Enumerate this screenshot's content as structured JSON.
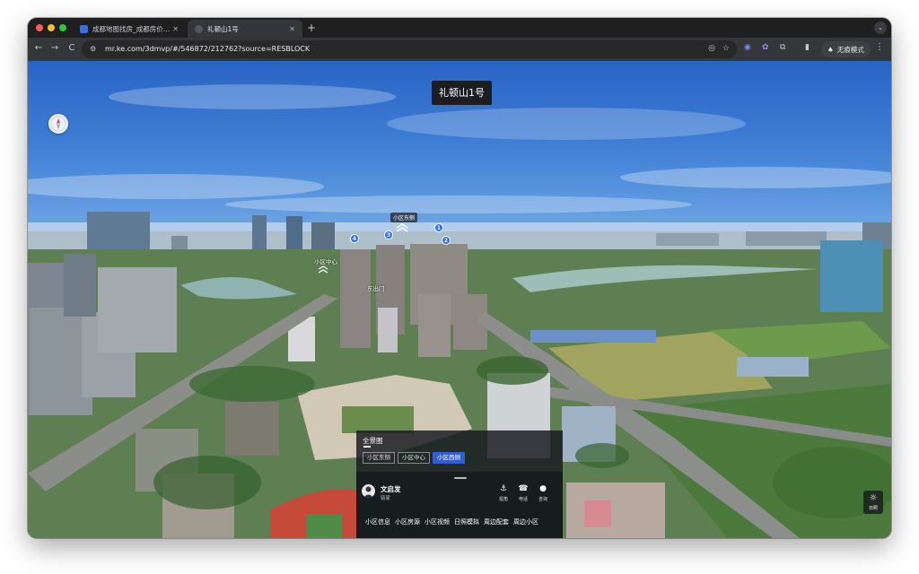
{
  "browser": {
    "tabs": [
      {
        "title": "成都地图找房_成都房价地图 |",
        "active": false
      },
      {
        "title": "礼顿山1号",
        "active": true
      }
    ],
    "new_tab": "+",
    "tab_menu": "⌄",
    "nav": {
      "back": "←",
      "forward": "→",
      "reload": "C"
    },
    "url": "mr.ke.com/3dmvp/#/546872/212762?source=RESBLOCK",
    "incognito_label": "无痕模式",
    "colors": {
      "tab_bg": "#1f1f1f",
      "toolbar_bg": "#35363a",
      "omnibox_bg": "#282828"
    }
  },
  "viewer": {
    "title": "礼顿山1号",
    "markers": [
      {
        "num": "1"
      },
      {
        "num": "2"
      },
      {
        "num": "3"
      },
      {
        "num": "4"
      }
    ],
    "labels": {
      "east": "小区东侧",
      "center": "小区中心",
      "exit": "东出门"
    },
    "panel": {
      "title": "全景图",
      "tabs": [
        {
          "label": "小区东侧",
          "active": false
        },
        {
          "label": "小区中心",
          "active": false
        },
        {
          "label": "小区西侧",
          "active": true
        }
      ],
      "agent": {
        "name": "文启发",
        "role": "链家"
      },
      "actions": [
        {
          "label": "视角",
          "icon": "anchor-icon"
        },
        {
          "label": "电话",
          "icon": "phone-icon"
        },
        {
          "label": "咨询",
          "icon": "chat-icon"
        }
      ],
      "links": [
        "小区信息",
        "小区房源",
        "小区视频",
        "日照模拟",
        "周边配套",
        "周边小区"
      ]
    },
    "sun_button": "日照",
    "accent_color": "#2f6ff0"
  }
}
